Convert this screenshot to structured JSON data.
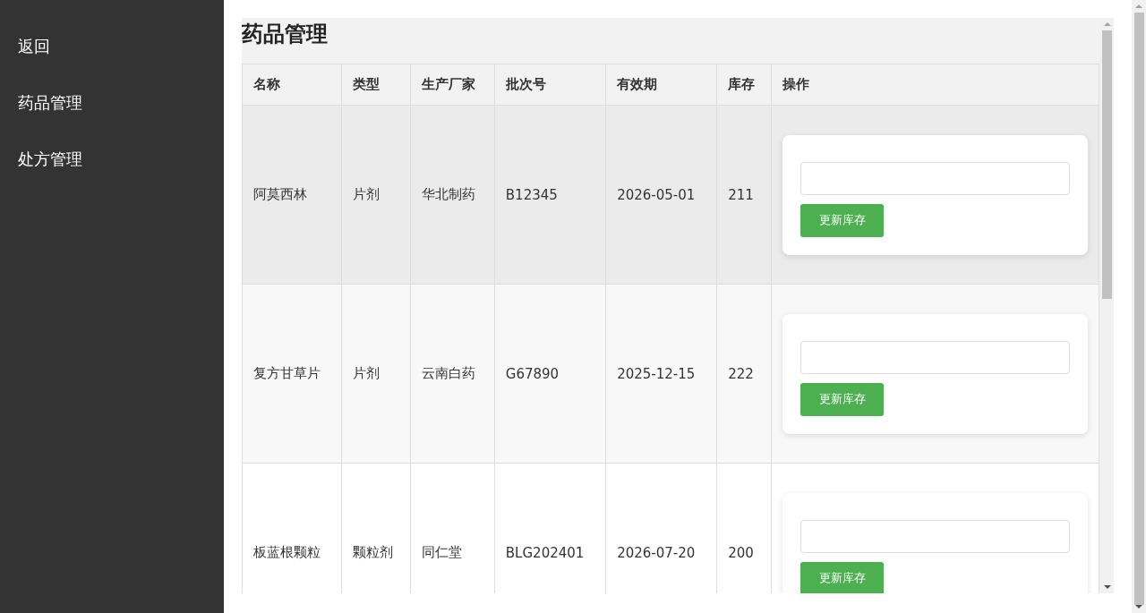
{
  "sidebar": {
    "items": [
      {
        "label": "返回"
      },
      {
        "label": "药品管理"
      },
      {
        "label": "处方管理"
      }
    ]
  },
  "page": {
    "title": "药品管理"
  },
  "table": {
    "columns": [
      "名称",
      "类型",
      "生产厂家",
      "批次号",
      "有效期",
      "库存",
      "操作"
    ],
    "rows": [
      {
        "cells": [
          "阿莫西林",
          "片剂",
          "华北制药",
          "B12345",
          "2026-05-01",
          "211"
        ],
        "hovered": true,
        "action": {
          "button": "更新库存"
        }
      },
      {
        "cells": [
          "复方甘草片",
          "片剂",
          "云南白药",
          "G67890",
          "2025-12-15",
          "222"
        ],
        "hovered": false,
        "action": {
          "button": "更新库存"
        }
      },
      {
        "cells": [
          "板蓝根颗粒",
          "颗粒剂",
          "同仁堂",
          "BLG202401",
          "2026-07-20",
          "200"
        ],
        "hovered": false,
        "action": {
          "button": "更新库存"
        }
      }
    ]
  }
}
